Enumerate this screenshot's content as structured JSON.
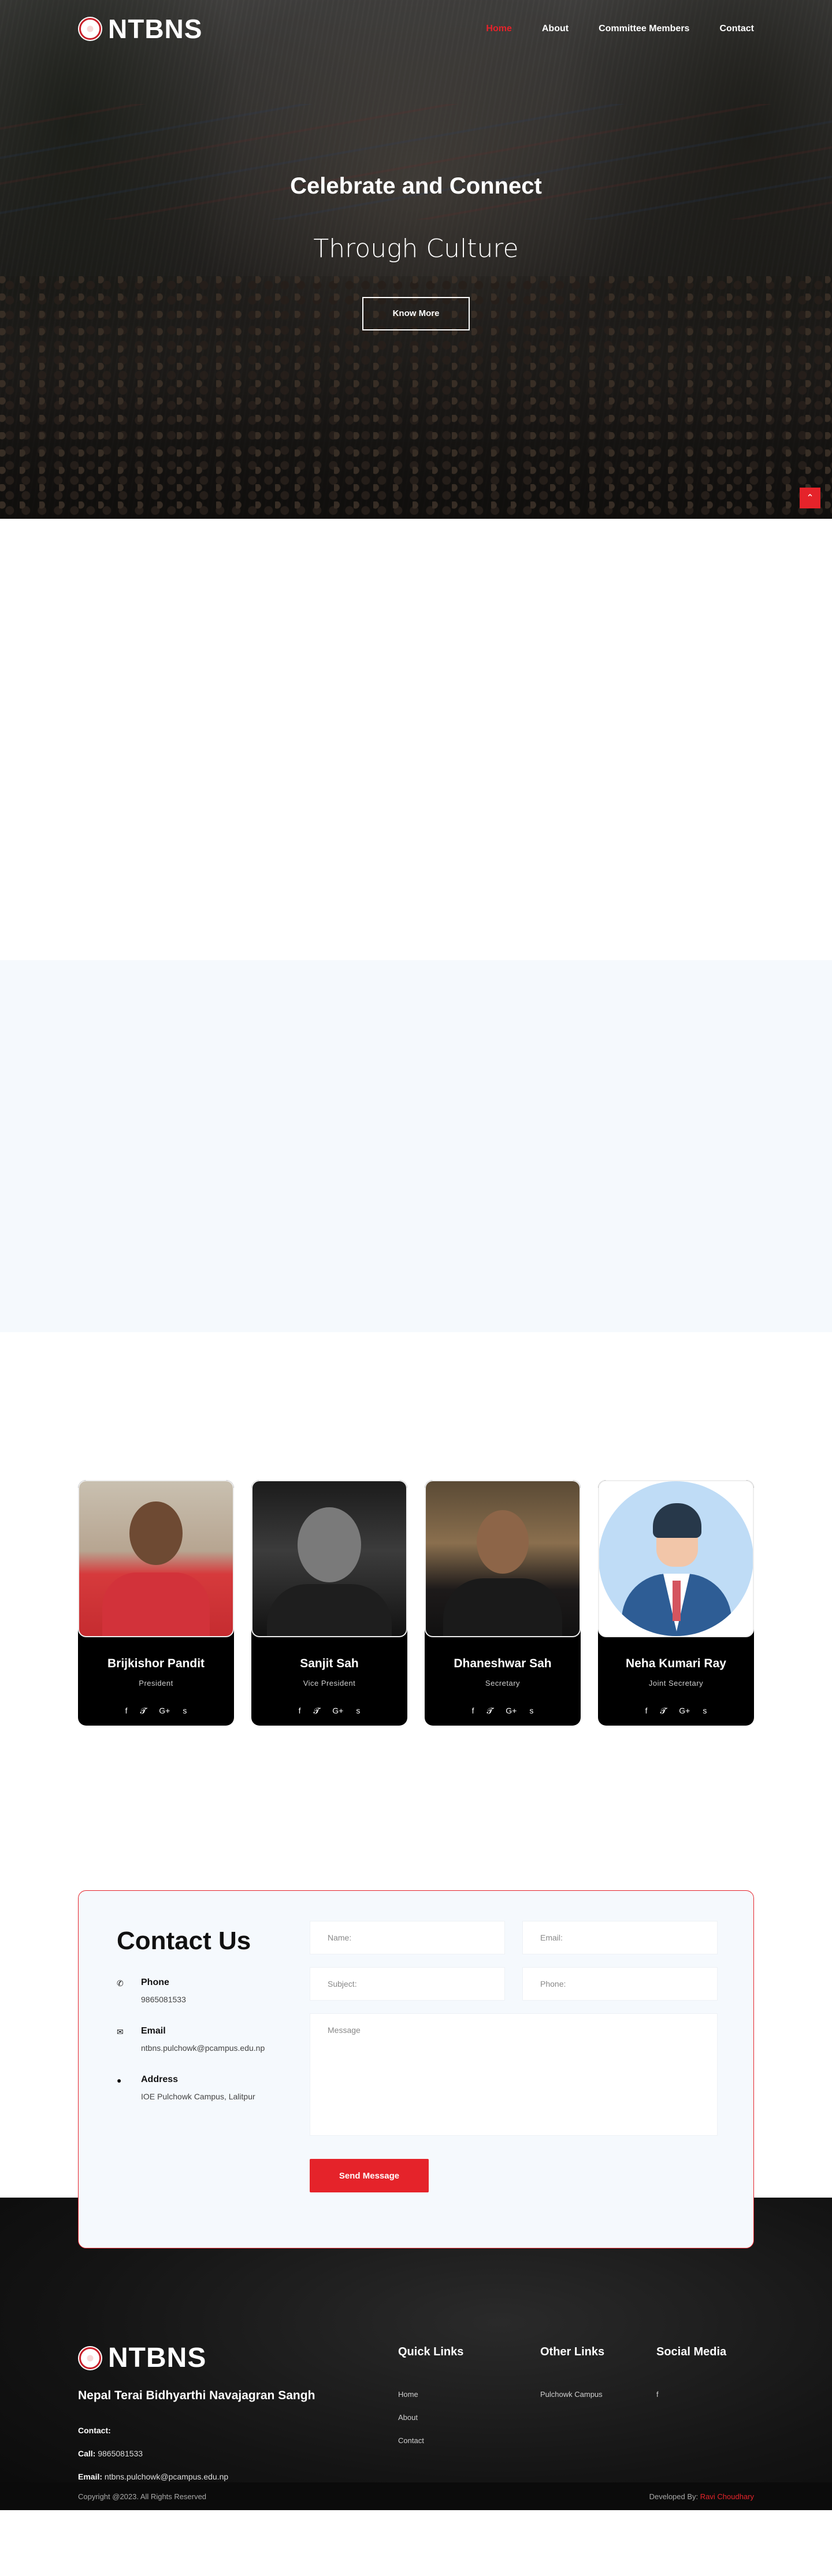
{
  "nav": {
    "brand": "NTBNS",
    "links": [
      "Home",
      "About",
      "Committee Members",
      "Contact"
    ]
  },
  "hero": {
    "title": "Celebrate and Connect",
    "subtitle": "Through Culture",
    "button": "Know More",
    "scroll_top_icon": "chevron-up"
  },
  "team": [
    {
      "name": "Brijkishor Pandit",
      "role": "President"
    },
    {
      "name": "Sanjit Sah",
      "role": "Vice President"
    },
    {
      "name": "Dhaneshwar Sah",
      "role": "Secretary"
    },
    {
      "name": "Neha Kumari Ray",
      "role": "Joint Secretary"
    }
  ],
  "social_icons": [
    "f",
    "t",
    "G+",
    "s"
  ],
  "contact": {
    "heading": "Contact Us",
    "phone_title": "Phone",
    "phone": "9865081533",
    "email_title": "Email",
    "email": "ntbns.pulchowk@pcampus.edu.np",
    "address_title": "Address",
    "address": "IOE Pulchowk Campus, Lalitpur",
    "form": {
      "name": "Name:",
      "email": "Email:",
      "subject": "Subject:",
      "phone": "Phone:",
      "message": "Message",
      "submit": "Send Message"
    }
  },
  "footer": {
    "brand": "NTBNS",
    "org": "Nepal Terai Bidhyarthi Navajagran Sangh",
    "contact_label": "Contact:",
    "call_label": "Call:",
    "call_value": "9865081533",
    "email_label": "Email:",
    "email_value": "ntbns.pulchowk@pcampus.edu.np",
    "quick_links_title": "Quick Links",
    "quick_links": [
      "Home",
      "About",
      "Contact"
    ],
    "other_links_title": "Other Links",
    "other_links": [
      "Pulchowk Campus"
    ],
    "social_title": "Social Media",
    "social_icon": "f",
    "copyright": "Copyright @2023. All Rights Reserved",
    "developed_by": "Developed By:",
    "developer": "Ravi Choudhary"
  },
  "colors": {
    "accent": "#e5232a",
    "section_bg": "#f5f9fd"
  }
}
